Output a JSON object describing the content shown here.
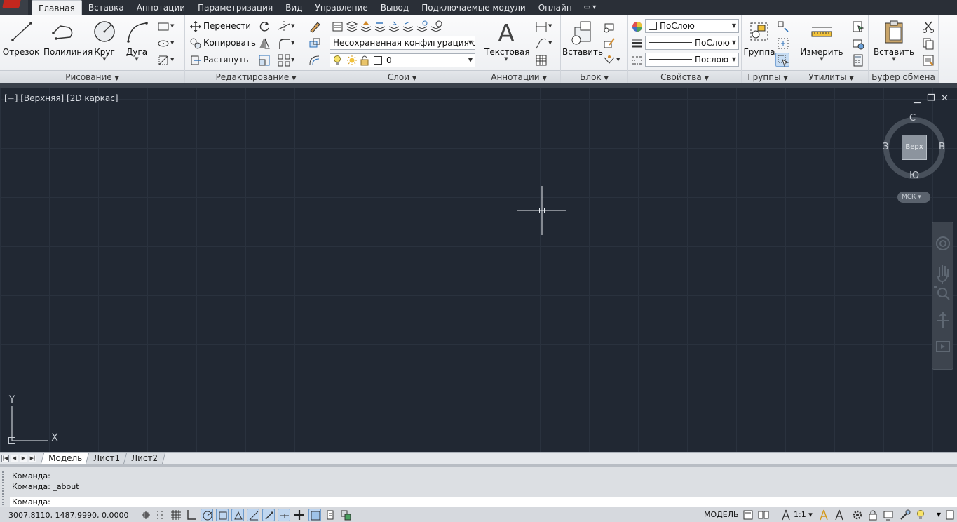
{
  "app": {
    "logo_icon": "autocad-logo-icon"
  },
  "tabs": [
    {
      "label": "Главная",
      "active": true
    },
    {
      "label": "Вставка"
    },
    {
      "label": "Аннотации"
    },
    {
      "label": "Параметризация"
    },
    {
      "label": "Вид"
    },
    {
      "label": "Управление"
    },
    {
      "label": "Вывод"
    },
    {
      "label": "Подключаемые модули"
    },
    {
      "label": "Онлайн"
    }
  ],
  "tabs_extra": "▭ ▾",
  "ribbon": {
    "draw": {
      "title": "Рисование",
      "line": "Отрезок",
      "polyline": "Полилиния",
      "circle": "Круг",
      "arc": "Дуга"
    },
    "modify": {
      "title": "Редактирование",
      "move": "Перенести",
      "copy": "Копировать",
      "stretch": "Растянуть"
    },
    "layers": {
      "title": "Слои",
      "state": "Несохраненная конфигурация сло",
      "layer": "0"
    },
    "annotation": {
      "title": "Аннотации",
      "text": "Текстовая"
    },
    "block": {
      "title": "Блок",
      "insert": "Вставить"
    },
    "properties": {
      "title": "Свойства",
      "color": "ПоСлою",
      "lineweight": "ПоСлою",
      "linetype": "Послою"
    },
    "groups": {
      "title": "Группы",
      "group": "Группа"
    },
    "utilities": {
      "title": "Утилиты",
      "measure": "Измерить"
    },
    "clipboard": {
      "title": "Буфер обмена",
      "paste": "Вставить"
    }
  },
  "viewport": {
    "label": "[−] [Верхняя] [2D каркас]",
    "minimize": "▁",
    "restore": "❐",
    "close": "✕"
  },
  "viewcube": {
    "north": "С",
    "south": "Ю",
    "east": "В",
    "west": "З",
    "face": "Верх",
    "ucs": "МСК ▾"
  },
  "ucs_icon": {
    "x": "X",
    "y": "Y"
  },
  "layout_tabs": [
    "Модель",
    "Лист1",
    "Лист2"
  ],
  "command": {
    "history": [
      "Команда:",
      "Команда: _about"
    ],
    "prompt": "Команда:"
  },
  "status": {
    "coords": "3007.8110, 1487.9990, 0.0000",
    "model": "МОДЕЛЬ",
    "scale": "1:1 ▾"
  },
  "colors": {
    "accent": "#c6dcf3",
    "canvas": "#212833",
    "logo": "#c2271e"
  }
}
